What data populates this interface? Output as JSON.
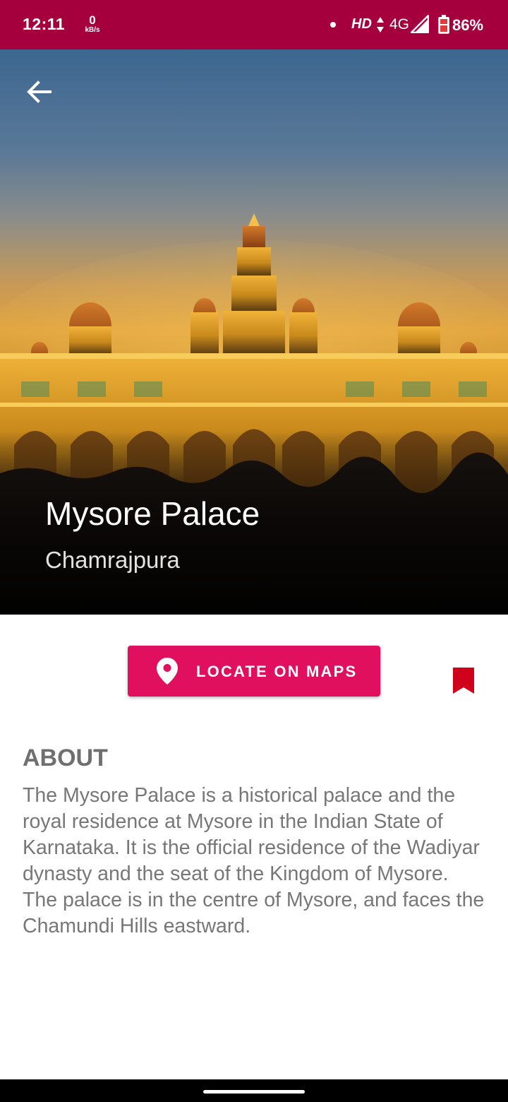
{
  "status_bar": {
    "time": "12:11",
    "net_speed_value": "0",
    "net_speed_unit": "kB/s",
    "hd_label": "HD",
    "network_type": "4G",
    "battery_percent": "86%",
    "background_color": "#a5003d"
  },
  "hero": {
    "title": "Mysore Palace",
    "subtitle": "Chamrajpura",
    "back_icon": "arrow-left-icon"
  },
  "actions": {
    "locate_label": "LOCATE ON MAPS",
    "locate_icon": "map-pin-icon",
    "locate_color": "#e0105e",
    "bookmark_icon": "bookmark-icon",
    "bookmark_color": "#d0021b"
  },
  "about": {
    "heading": "ABOUT",
    "body": "The Mysore Palace is a historical palace and the royal residence at Mysore in the Indian State of Karnataka. It is the official residence of the Wadiyar dynasty and the seat of the Kingdom of Mysore. The palace is in the centre of Mysore, and faces the Chamundi Hills eastward."
  }
}
